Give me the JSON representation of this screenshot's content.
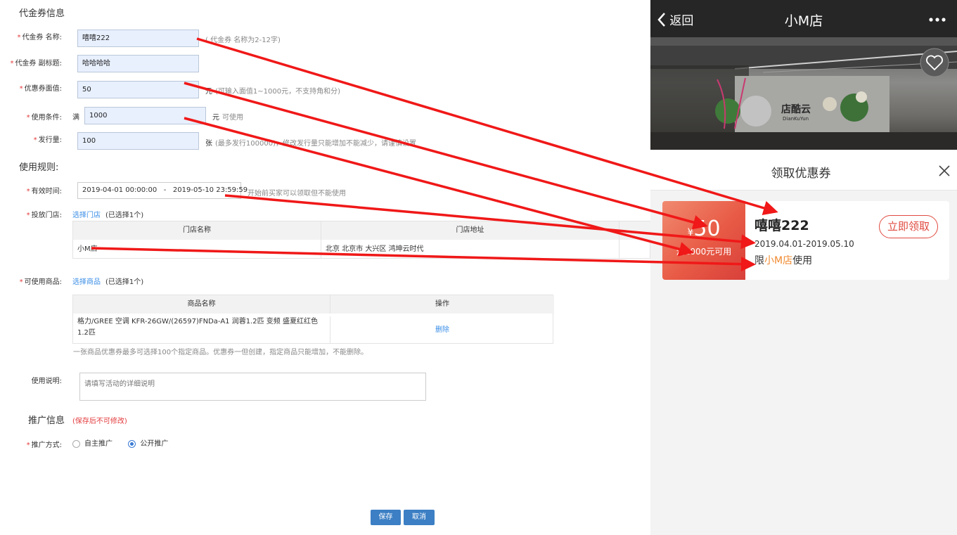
{
  "form": {
    "section1_title": "代金券信息",
    "name": {
      "label": "代金券 名称:",
      "value": "嘻嘻222",
      "hint": "( 代金券 名称为2-12字)"
    },
    "subtitle": {
      "label": "代金券 副标题:",
      "value": "哈哈哈哈"
    },
    "face_value": {
      "label": "优惠券面值:",
      "value": "50",
      "unit": "元",
      "hint": "(可输入面值1~1000元，不支持角和分)"
    },
    "condition": {
      "label": "使用条件:",
      "prefix": "满",
      "value": "1000",
      "unit": "元",
      "hint": "可使用"
    },
    "quantity": {
      "label": "发行量:",
      "value": "100",
      "unit": "张",
      "hint": "(最多发行100000)，修改发行量只能增加不能减少，请谨慎设置"
    },
    "section2_title": "使用规则:",
    "validity": {
      "label": "有效时间:",
      "start": "2019-04-01 00:00:00",
      "sep": "-",
      "end": "2019-05-10 23:59:59",
      "hint": "开始前买家可以领取但不能使用"
    },
    "stores": {
      "label": "投放门店:",
      "link": "选择门店",
      "count": "(已选择1个)",
      "headers": [
        "门店名称",
        "门店地址"
      ],
      "rows": [
        {
          "name": "小M店",
          "address": "北京 北京市 大兴区 鸿坤云时代"
        }
      ]
    },
    "goods": {
      "label": "可使用商品:",
      "link": "选择商品",
      "count": "(已选择1个)",
      "headers": [
        "商品名称",
        "操作"
      ],
      "rows": [
        {
          "name": "格力/GREE 空调 KFR-26GW/(26597)FNDa-A1 润蓉1.2匹 变频 盛夏红红色 1.2匹",
          "action": "删除"
        }
      ],
      "note": "一张商品优惠券最多可选择100个指定商品。优惠券一但创建，指定商品只能增加，不能删除。"
    },
    "description": {
      "label": "使用说明:",
      "placeholder": "请填写活动的详细说明"
    },
    "promo_title": "推广信息",
    "promo_note": "(保存后不可修改)",
    "promo": {
      "label": "推广方式:",
      "options": [
        "自主推广",
        "公开推广"
      ],
      "selected": "公开推广"
    },
    "save_label": "保存",
    "cancel_label": "取消"
  },
  "phone": {
    "back_label": "返回",
    "title": "小M店",
    "more_icon": "more-dots-icon",
    "photo_sign": "店酷云",
    "photo_sign_en": "DianKuYun",
    "sheet_title": "领取优惠券",
    "coupon": {
      "currency": "¥",
      "amount": "50",
      "condition": "满1000元可用",
      "name": "嘻嘻222",
      "dates": "2019.04.01-2019.05.10",
      "limit_prefix": "限",
      "store": "小M店",
      "limit_suffix": "使用",
      "claim_label": "立即领取"
    }
  },
  "colors": {
    "arrow": "#f01818",
    "accent_blue": "#3a8ee6",
    "coupon_red": "#e85a45",
    "store_orange": "#f08a30"
  }
}
